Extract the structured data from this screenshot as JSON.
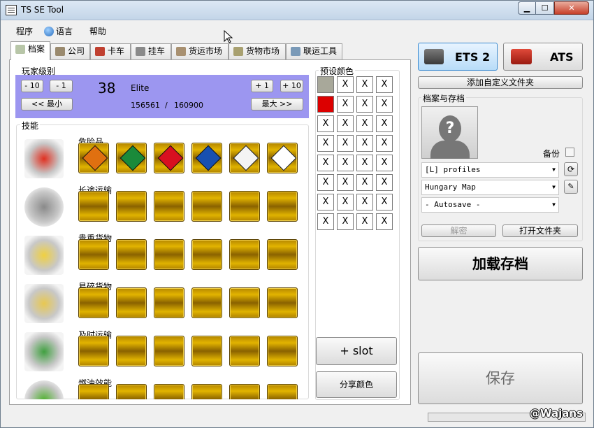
{
  "window": {
    "title": "TS SE Tool",
    "min": "▁",
    "max": "☐",
    "close": "✕"
  },
  "menu": [
    {
      "label": "程序"
    },
    {
      "label": "语言"
    },
    {
      "label": "帮助"
    }
  ],
  "tabs": [
    {
      "label": "档案",
      "icon": "profile-icon"
    },
    {
      "label": "公司",
      "icon": "company-icon"
    },
    {
      "label": "卡车",
      "icon": "truck-icon"
    },
    {
      "label": "挂车",
      "icon": "trailer-icon"
    },
    {
      "label": "货运市场",
      "icon": "freight-market-icon"
    },
    {
      "label": "货物市场",
      "icon": "cargo-market-icon"
    },
    {
      "label": "联运工具",
      "icon": "convoy-tools-icon"
    }
  ],
  "player_level": {
    "title": "玩家级别",
    "minus10": "- 10",
    "minus1": "- 1",
    "plus1": "+ 1",
    "plus10": "+ 10",
    "min_btn": "<< 最小",
    "max_btn": "最大 >>",
    "level": "38",
    "rank": "Elite",
    "xp_current": "156561",
    "xp_sep": "/",
    "xp_next": "160900"
  },
  "skills": {
    "title": "技能",
    "list": [
      {
        "name": "危险品",
        "icon": "adr-skill-icon"
      },
      {
        "name": "长途运输",
        "icon": "long-distance-skill-icon"
      },
      {
        "name": "贵重货物",
        "icon": "high-value-cargo-skill-icon"
      },
      {
        "name": "易碎货物",
        "icon": "fragile-cargo-skill-icon"
      },
      {
        "name": "及时运输",
        "icon": "just-in-time-skill-icon"
      },
      {
        "name": "燃油效能",
        "icon": "eco-driving-skill-icon"
      }
    ],
    "adr_slots": [
      {
        "icon": "explosives-icon",
        "color": "#e07010"
      },
      {
        "icon": "gas-icon",
        "color": "#1a8a3a"
      },
      {
        "icon": "flammable-icon",
        "color": "#d81020"
      },
      {
        "icon": "water-reactive-icon",
        "color": "#1850b0"
      },
      {
        "icon": "toxic-icon",
        "color": "#f4f4f4"
      },
      {
        "icon": "corrosive-icon",
        "color": "#ffffff"
      }
    ]
  },
  "preset_colors": {
    "title": "预设颜色",
    "swatches": [
      [
        "#a8a89a",
        "X",
        "X",
        "X"
      ],
      [
        "#dc0000",
        "X",
        "X",
        "X"
      ],
      [
        "X",
        "X",
        "X",
        "X"
      ],
      [
        "X",
        "X",
        "X",
        "X"
      ],
      [
        "X",
        "X",
        "X",
        "X"
      ],
      [
        "X",
        "X",
        "X",
        "X"
      ],
      [
        "X",
        "X",
        "X",
        "X"
      ],
      [
        "X",
        "X",
        "X",
        "X"
      ]
    ],
    "add_slot": "+ slot",
    "share": "分享颜色"
  },
  "game": {
    "ets2": "ETS 2",
    "ats": "ATS"
  },
  "custom_folder": "添加自定义文件夹",
  "profiles": {
    "title": "档案与存档",
    "backup_label": "备份",
    "profile_combo": "[L] profiles",
    "profile_name": "Hungary Map",
    "save_combo": "- Autosave -",
    "decrypt": "解密",
    "open_folder": "打开文件夹"
  },
  "load_save": "加载存档",
  "save": "保存",
  "credit": "@Wajans"
}
